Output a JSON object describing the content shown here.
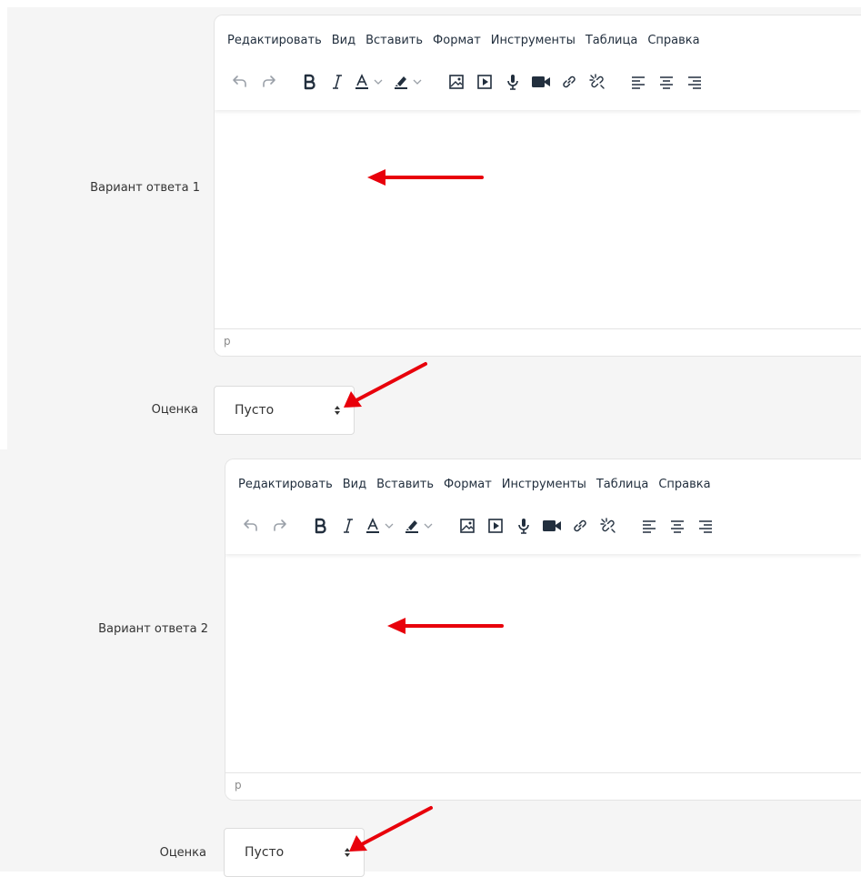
{
  "colors": {
    "panel_bg": "#f5f5f5",
    "editor_border": "#e4e4e4",
    "menu_text": "#222f3e",
    "annotation_arrow": "#e8000b"
  },
  "editors": [
    {
      "label": "Вариант ответа 1",
      "menu": [
        "Редактировать",
        "Вид",
        "Вставить",
        "Формат",
        "Инструменты",
        "Таблица",
        "Справка"
      ],
      "status_path": "p"
    },
    {
      "label": "Вариант ответа 2",
      "menu": [
        "Редактировать",
        "Вид",
        "Вставить",
        "Формат",
        "Инструменты",
        "Таблица",
        "Справка"
      ],
      "status_path": "p"
    }
  ],
  "grades": [
    {
      "label": "Оценка",
      "value": "Пусто"
    },
    {
      "label": "Оценка",
      "value": "Пусто"
    }
  ],
  "toolbar_icons": [
    "undo-icon",
    "redo-icon",
    "bold-icon",
    "italic-icon",
    "text-color-icon",
    "highlight-color-icon",
    "image-icon",
    "media-icon",
    "microphone-icon",
    "video-camera-icon",
    "link-icon",
    "unlink-icon",
    "align-left-icon",
    "align-center-icon",
    "align-right-icon"
  ]
}
